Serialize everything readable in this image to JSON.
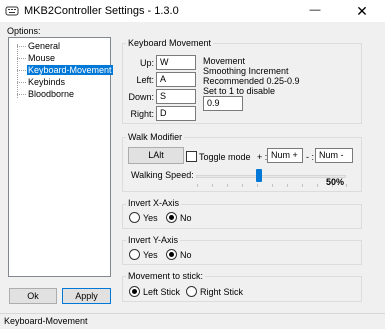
{
  "window": {
    "title": "MKB2Controller Settings  -  1.3.0",
    "minimize_glyph": "—",
    "close_glyph": "✕"
  },
  "sidebar": {
    "label": "Options:",
    "items": [
      {
        "label": "General"
      },
      {
        "label": "Mouse"
      },
      {
        "label": "Keyboard-Movement",
        "selected": true
      },
      {
        "label": "Keybinds"
      },
      {
        "label": "Bloodborne"
      }
    ],
    "ok_label": "Ok",
    "apply_label": "Apply"
  },
  "keyboard_movement": {
    "title": "Keyboard Movement",
    "up_label": "Up:",
    "up_value": "W",
    "left_label": "Left:",
    "left_value": "A",
    "down_label": "Down:",
    "down_value": "S",
    "right_label": "Right:",
    "right_value": "D",
    "info_line1": "Movement",
    "info_line2": "Smoothing Increment",
    "info_line3": "Recommended 0.25-0.9",
    "info_line4": "Set to 1 to disable",
    "smoothing_value": "0.9"
  },
  "walk_modifier": {
    "title": "Walk Modifier",
    "key_button": "LAlt",
    "toggle_label": "Toggle mode",
    "toggle_checked": false,
    "plus_label": "+ :",
    "plus_value": "Num +",
    "minus_label": "- :",
    "minus_value": "Num -",
    "speed_label": "Walking Speed:",
    "speed_value": "50%",
    "speed_fraction": 0.5
  },
  "invert_x": {
    "title": "Invert X-Axis",
    "yes_label": "Yes",
    "no_label": "No",
    "selected": "no"
  },
  "invert_y": {
    "title": "Invert Y-Axis",
    "yes_label": "Yes",
    "no_label": "No",
    "selected": "no"
  },
  "movement_stick": {
    "title": "Movement to stick:",
    "left_label": "Left Stick",
    "right_label": "Right Stick",
    "selected": "left"
  },
  "status": {
    "text": "Keyboard-Movement"
  },
  "colors": {
    "accent": "#0078d7",
    "window_bg": "#f0f0f0"
  }
}
